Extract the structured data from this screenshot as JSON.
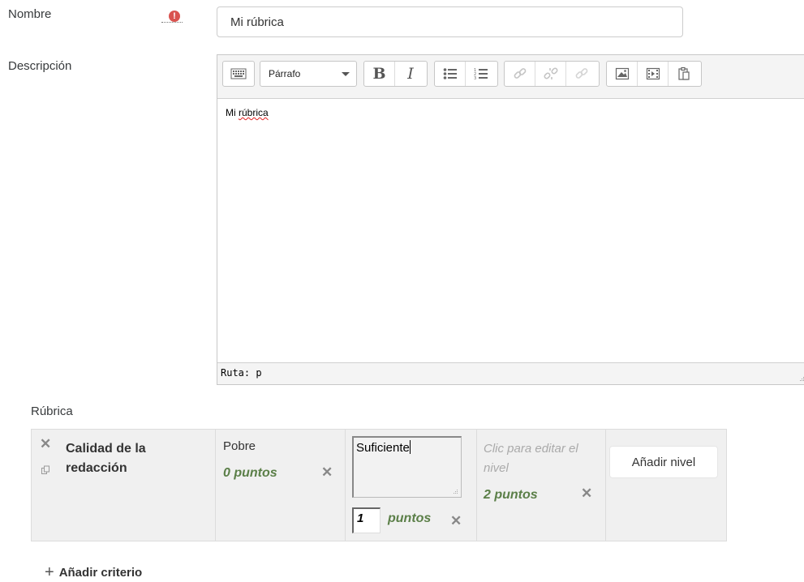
{
  "name_field": {
    "label": "Nombre",
    "required_icon": "exclamation-icon",
    "value": "Mi rúbrica"
  },
  "description_field": {
    "label": "Descripción"
  },
  "editor": {
    "toolbar": {
      "format_select": "Párrafo",
      "buttons": [
        "toolbar-toggle-icon",
        "bold-icon",
        "italic-icon",
        "unordered-list-icon",
        "ordered-list-icon",
        "link-icon",
        "unlink-icon",
        "anchor-icon",
        "image-icon",
        "media-icon",
        "paste-icon"
      ]
    },
    "content": "Mi rúbrica",
    "path": "Ruta: p"
  },
  "rubric": {
    "label": "Rúbrica",
    "criterion": {
      "title": "Calidad de la redacción",
      "title_line1": "Calidad de la",
      "title_line2": "redacción"
    },
    "levels": [
      {
        "definition": "Pobre",
        "points_text": "0 puntos",
        "points": 0
      },
      {
        "definition": "Suficiente",
        "points_value": "1",
        "points_label": "puntos",
        "points": 1
      },
      {
        "definition_placeholder": "Clic para editar el nivel",
        "placeholder_line1": "Clic para editar el",
        "placeholder_line2": "nivel",
        "points_text": "2 puntos",
        "points": 2
      }
    ],
    "add_level_label": "Añadir nivel",
    "add_criterion_label": "Añadir criterio"
  },
  "colors": {
    "points_green": "#5b7f48",
    "required_red": "#d9534f",
    "table_bg": "#f0f0f0"
  }
}
